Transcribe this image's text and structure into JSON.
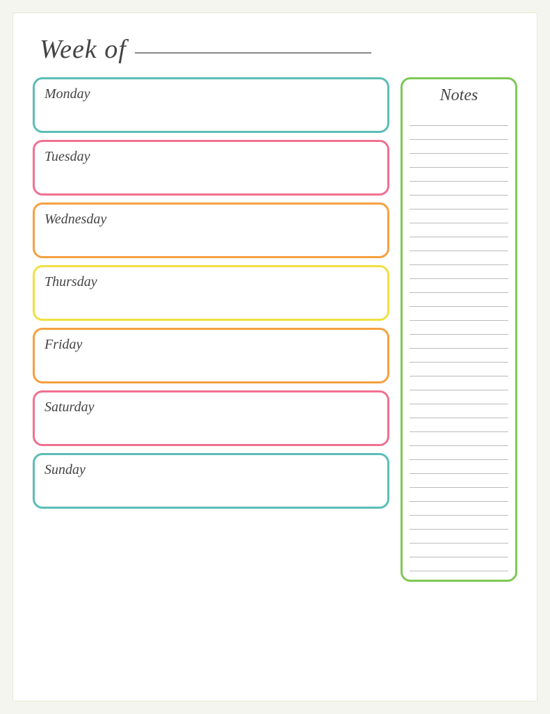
{
  "header": {
    "week_of_label": "Week of"
  },
  "days": [
    {
      "id": "monday",
      "label": "Monday",
      "color_class": "monday-box"
    },
    {
      "id": "tuesday",
      "label": "Tuesday",
      "color_class": "tuesday-box"
    },
    {
      "id": "wednesday",
      "label": "Wednesday",
      "color_class": "wednesday-box"
    },
    {
      "id": "thursday",
      "label": "Thursday",
      "color_class": "thursday-box"
    },
    {
      "id": "friday",
      "label": "Friday",
      "color_class": "friday-box"
    },
    {
      "id": "saturday",
      "label": "Saturday",
      "color_class": "saturday-box"
    },
    {
      "id": "sunday",
      "label": "Sunday",
      "color_class": "sunday-box"
    }
  ],
  "notes": {
    "title": "Notes",
    "line_count": 33
  },
  "colors": {
    "monday": "#5bbdb5",
    "tuesday": "#f07090",
    "wednesday": "#f5a040",
    "thursday": "#f0e040",
    "friday": "#f5a040",
    "saturday": "#f07090",
    "sunday": "#5bbdb5",
    "notes": "#7dc854"
  }
}
